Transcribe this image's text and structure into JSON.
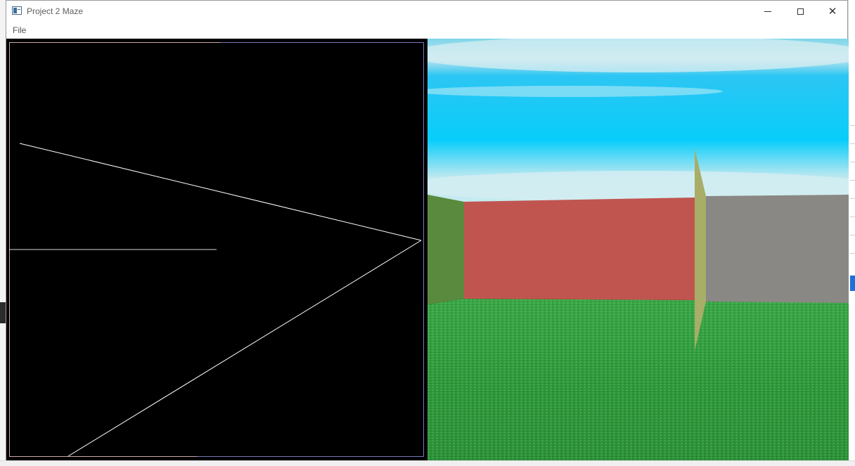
{
  "window": {
    "title": "Project 2 Maze",
    "controls": {
      "minimize": "minimize",
      "maximize": "maximize",
      "close": "✕"
    }
  },
  "menubar": {
    "items": [
      {
        "label": "File"
      }
    ]
  },
  "views": {
    "map": {
      "name": "top-down-map"
    },
    "scene": {
      "name": "3d-maze-view"
    }
  },
  "colors": {
    "map_background": "#000000",
    "map_lines": "#ffffff",
    "sky": "#16c6f0",
    "wall_green": "#5a8a3e",
    "wall_red": "#c05550",
    "wall_grey": "#8a8884",
    "wall_yellow": "#a8ad68",
    "grass": "#2f9a3a"
  }
}
